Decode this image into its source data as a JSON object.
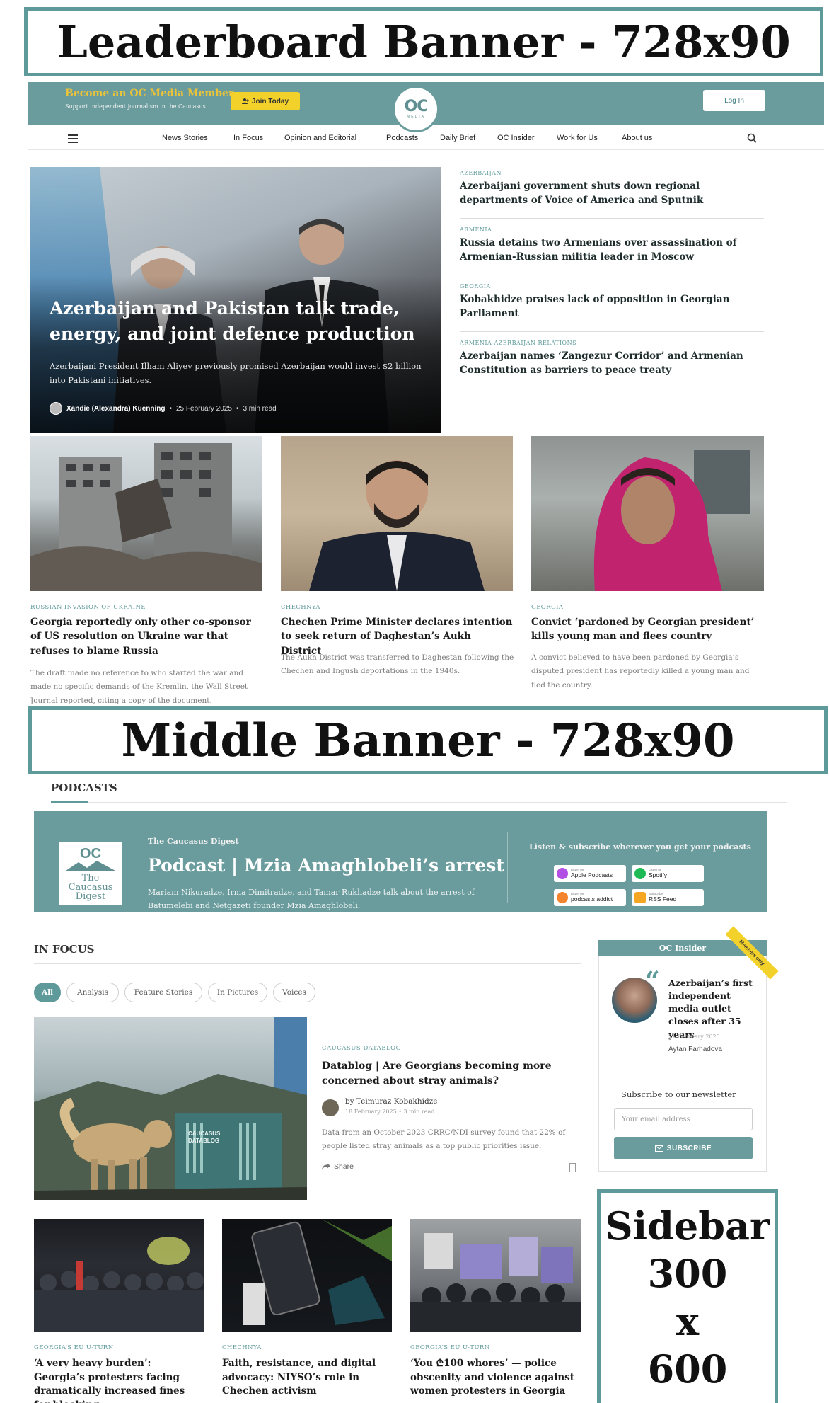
{
  "ads": {
    "top": "Leaderboard Banner - 728x90",
    "middle": "Middle Banner - 728x90",
    "sidebar": [
      "Sidebar",
      "300",
      "x",
      "600"
    ]
  },
  "header": {
    "member_title": "Become an OC Media Member",
    "member_sub": "Support independent journalism in the Caucasus",
    "join_label": "Join Today",
    "logo": "OC",
    "logo_sub": "MEDIA",
    "login_label": "Log In"
  },
  "nav": {
    "items": [
      "News Stories",
      "In Focus",
      "Opinion and Editorial",
      "Podcasts",
      "Daily Brief",
      "OC Insider",
      "Work for Us",
      "About us"
    ]
  },
  "hero": {
    "title": "Azerbaijan and Pakistan talk trade, energy, and joint defence production",
    "excerpt": "Azerbaijani President Ilham Aliyev previously promised Azerbaijan would invest $2 billion into Pakistani initiatives.",
    "author": "Xandie (Alexandra) Kuenning",
    "date": "25 February 2025",
    "read_time": "3 min read"
  },
  "side_list": [
    {
      "tag": "AZERBAIJAN",
      "title": "Azerbaijani government shuts down regional departments of Voice of America and Sputnik"
    },
    {
      "tag": "ARMENIA",
      "title": "Russia detains two Armenians over assassination of Armenian-Russian militia leader in Moscow"
    },
    {
      "tag": "GEORGIA",
      "title": "Kobakhidze praises lack of opposition in Georgian Parliament"
    },
    {
      "tag": "ARMENIA-AZERBAIJAN RELATIONS",
      "title": "Azerbaijan names ‘Zangezur Corridor’ and Armenian Constitution as barriers to peace treaty"
    }
  ],
  "thumbs": [
    {
      "tag": "RUSSIAN INVASION OF UKRAINE",
      "title": "Georgia reportedly only other co-sponsor of US resolution on Ukraine war that refuses to blame Russia",
      "excerpt": "The draft made no reference to who started the war and made no specific demands of the Kremlin, the Wall Street Journal reported, citing a copy of the document."
    },
    {
      "tag": "CHECHNYA",
      "title": "Chechen Prime Minister declares intention to seek return of Daghestan’s Aukh District",
      "excerpt": "The Aukh District was transferred to Daghestan following the Chechen and Ingush deportations in the 1940s."
    },
    {
      "tag": "GEORGIA",
      "title": "Convict ‘pardoned by Georgian president’ kills young man and flees country",
      "excerpt": "A convict believed to have been pardoned by Georgia’s disputed president has reportedly killed a young man and fled the country."
    }
  ],
  "podcasts": {
    "section": "PODCASTS",
    "show": "The Caucasus Digest",
    "art_name": "The Caucasus Digest",
    "title": "Podcast | Mzia Amaghlobeli’s arrest",
    "description": "Mariam Nikuradze, Irma Dimitradze, and Tamar Rukhadze talk about the arrest of Batumelebi and Netgazeti founder Mzia Amaghlobeli.",
    "listen": "Listen & subscribe wherever you get your podcasts",
    "platforms": [
      {
        "small": "Listen on",
        "label": "Apple Podcasts",
        "color": "#b150e2"
      },
      {
        "small": "Listen on",
        "label": "Spotify",
        "color": "#1db954"
      },
      {
        "small": "Listen on",
        "label": "podcasts addict",
        "color": "#f4842d"
      },
      {
        "small": "Subscribe",
        "label": "RSS Feed",
        "color": "#f5a623"
      }
    ]
  },
  "in_focus": {
    "section": "IN FOCUS",
    "filters": [
      "All",
      "Analysis",
      "Feature Stories",
      "In Pictures",
      "Voices"
    ],
    "active_filter": "All",
    "featured": {
      "image_caption": "CAUCASUS DATABLOG",
      "tag": "CAUCASUS DATABLOG",
      "title": "Datablog | Are Georgians becoming more concerned about stray animals?",
      "author": "by Teimuraz Kobakhidze",
      "date": "18 February 2025",
      "read_time": "3 min read",
      "excerpt": "Data from an October 2023 CRRC/NDI survey found that 22% of people listed stray animals as a top public priorities issue.",
      "share": "Share"
    }
  },
  "insider": {
    "header": "OC Insider",
    "ribbon": "Members only",
    "title": "Azerbaijan’s first independent media outlet closes after 35 years",
    "date": "21 February 2025",
    "author": "Aytan Farhadova",
    "newsletter_head": "Subscribe to our newsletter",
    "email_placeholder": "Your email address",
    "subscribe_label": "SUBSCRIBE"
  },
  "bottom": [
    {
      "tag": "GEORGIA’S EU U-TURN",
      "title": "‘A very heavy burden’: Georgia’s protesters facing dramatically increased fines for blocking"
    },
    {
      "tag": "CHECHNYA",
      "title": "Faith, resistance, and digital advocacy: NIYSO’s role in Chechen activism"
    },
    {
      "tag": "GEORGIA’S EU U-TURN",
      "title": "‘You ₾100 whores’ — police obscenity and violence against women protesters in Georgia"
    }
  ],
  "colors": {
    "teal": "#6a9c9d",
    "yellow": "#f2d12a",
    "accent_text": "#5f9a9b"
  }
}
